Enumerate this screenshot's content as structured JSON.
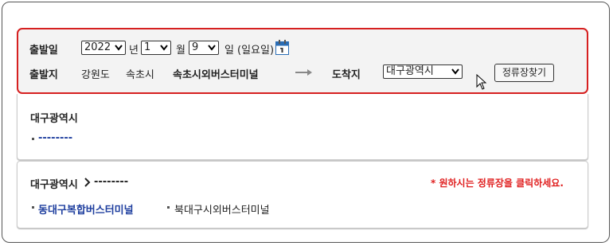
{
  "departure_date": {
    "label": "출발일",
    "year": "2022",
    "year_unit": "년",
    "month": "1",
    "month_unit": "월",
    "day": "9",
    "day_unit": "일",
    "weekday": "(일요일)"
  },
  "departure_place": {
    "label": "출발지",
    "province": "강원도",
    "city": "속초시",
    "terminal": "속초시외버스터미널"
  },
  "arrival": {
    "label": "도착지",
    "selected": "대구광역시"
  },
  "search_button": "정류장찾기",
  "section1": {
    "title": "대구광역시",
    "link": "--------"
  },
  "section2": {
    "title": "대구광역시",
    "subtitle": "--------",
    "notice": "* 원하시는 정류장을 클릭하세요.",
    "stops": [
      "동대구복합버스터미널",
      "북대구시외버스터미널"
    ]
  },
  "colors": {
    "accent_border": "#d62020",
    "link": "#1f3f9f",
    "notice": "#e02020"
  },
  "icons": [
    "calendar-icon",
    "right-arrow-icon",
    "mouse-cursor-icon",
    "chevron-down-icon"
  ]
}
